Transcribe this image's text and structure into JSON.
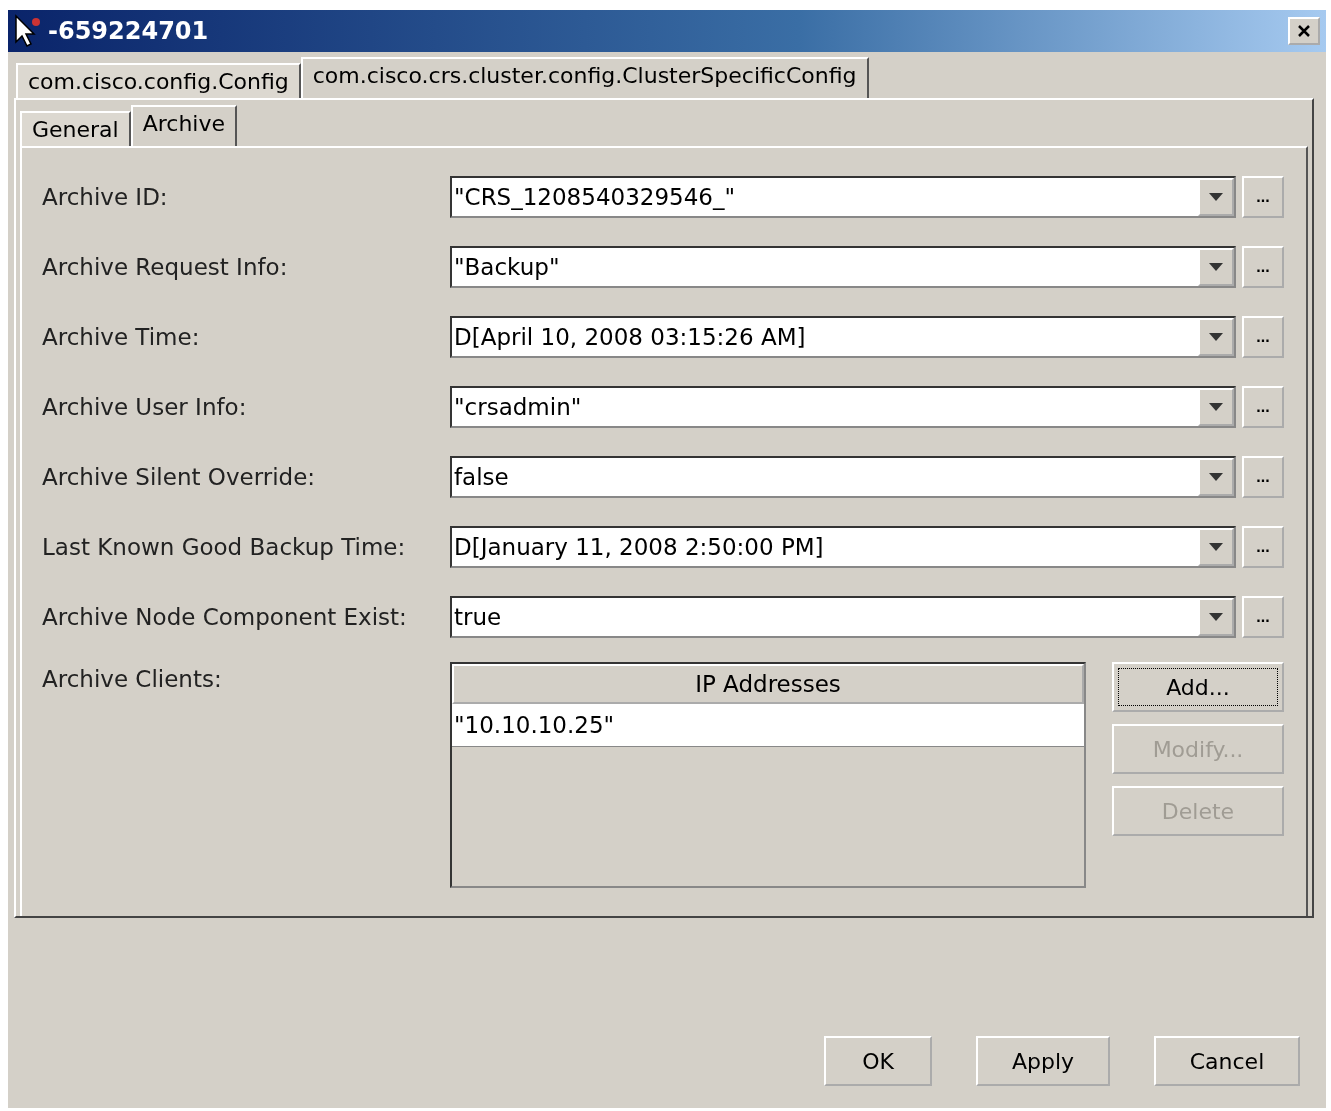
{
  "window": {
    "title": "-659224701"
  },
  "outer_tabs": [
    {
      "label": "com.cisco.config.Config",
      "selected": false
    },
    {
      "label": "com.cisco.crs.cluster.config.ClusterSpecificConfig",
      "selected": true
    }
  ],
  "inner_tabs": [
    {
      "label": "General",
      "selected": false
    },
    {
      "label": "Archive",
      "selected": true
    }
  ],
  "fields": [
    {
      "label": "Archive ID:",
      "value": "\"CRS_1208540329546_\"",
      "more": "..."
    },
    {
      "label": "Archive Request Info:",
      "value": "\"Backup\"",
      "more": "..."
    },
    {
      "label": "Archive Time:",
      "value": "D[April 10, 2008 03:15:26 AM]",
      "more": "..."
    },
    {
      "label": "Archive User Info:",
      "value": "\"crsadmin\"",
      "more": "..."
    },
    {
      "label": "Archive Silent Override:",
      "value": "false",
      "more": "..."
    },
    {
      "label": "Last Known Good Backup Time:",
      "value": "D[January 11, 2008 2:50:00 PM]",
      "more": "..."
    },
    {
      "label": "Archive Node Component Exist:",
      "value": "true",
      "more": "..."
    }
  ],
  "archive_clients": {
    "label": "Archive Clients:",
    "table": {
      "columns": [
        "IP Addresses"
      ],
      "rows": [
        "\"10.10.10.25\""
      ]
    },
    "buttons": [
      {
        "label": "Add...",
        "disabled": false,
        "focused": true
      },
      {
        "label": "Modify...",
        "disabled": true,
        "focused": false
      },
      {
        "label": "Delete",
        "disabled": true,
        "focused": false
      }
    ]
  },
  "footer_buttons": [
    "OK",
    "Apply",
    "Cancel"
  ]
}
